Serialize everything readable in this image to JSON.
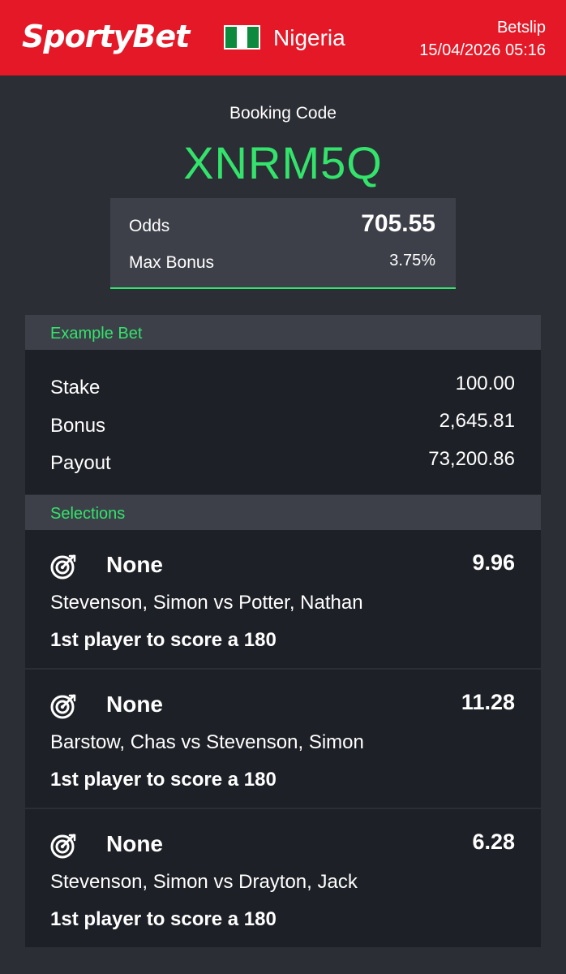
{
  "header": {
    "brand": "SportyBet",
    "country": "Nigeria",
    "betslip_label": "Betslip",
    "datetime": "15/04/2026 05:16"
  },
  "booking": {
    "label": "Booking Code",
    "code": "XNRM5Q",
    "odds_label": "Odds",
    "odds_value": "705.55",
    "max_bonus_label": "Max Bonus",
    "max_bonus_value": "3.75%"
  },
  "example_bet": {
    "title": "Example Bet",
    "rows": [
      {
        "label": "Stake",
        "value": "100.00"
      },
      {
        "label": "Bonus",
        "value": "2,645.81"
      },
      {
        "label": "Payout",
        "value": "73,200.86"
      }
    ]
  },
  "selections": {
    "title": "Selections",
    "items": [
      {
        "pick": "None",
        "odds": "9.96",
        "match": "Stevenson, Simon vs Potter, Nathan",
        "market": "1st player to score a 180",
        "icon": "dartboard-icon"
      },
      {
        "pick": "None",
        "odds": "11.28",
        "match": "Barstow, Chas vs Stevenson, Simon",
        "market": "1st player to score a 180",
        "icon": "dartboard-icon"
      },
      {
        "pick": "None",
        "odds": "6.28",
        "match": "Stevenson, Simon vs Drayton, Jack",
        "market": "1st player to score a 180",
        "icon": "dartboard-icon"
      }
    ]
  },
  "colors": {
    "brand_red": "#e41827",
    "accent_green": "#33e36b",
    "background": "#2b2e35",
    "panel": "#1d2026"
  }
}
